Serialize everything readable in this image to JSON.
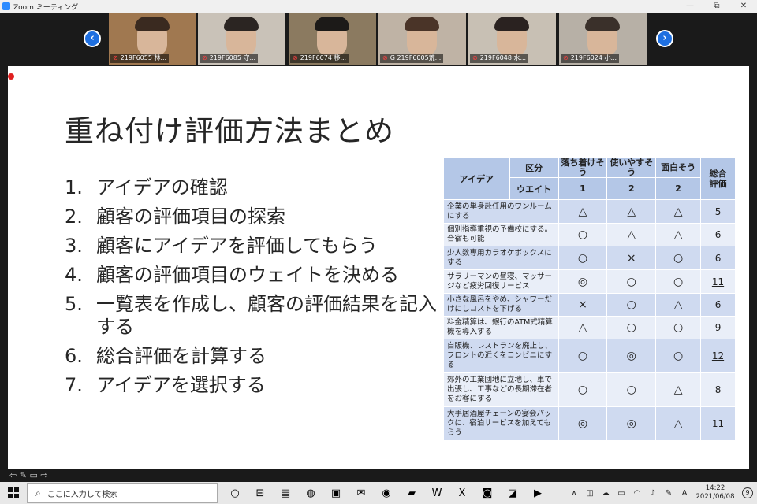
{
  "window": {
    "title": "Zoom ミーティング",
    "controls": [
      "—",
      "⧉",
      "✕"
    ]
  },
  "gallery": {
    "prev": "‹",
    "next": "›",
    "participants": [
      {
        "name": "219F6055 林...",
        "hair": "#3a2a20",
        "bg": "#a07850"
      },
      {
        "name": "219F6085 守...",
        "hair": "#2b2522",
        "bg": "#c9c2b8"
      },
      {
        "name": "219F6074 移...",
        "hair": "#1c1a18",
        "bg": "#8b7a60"
      },
      {
        "name": "G  219F6005荒...",
        "hair": "#4a3428",
        "bg": "#bfb3a5"
      },
      {
        "name": "219F6048 水...",
        "hair": "#2a2220",
        "bg": "#c8c0b4"
      },
      {
        "name": "219F6024 小...",
        "hair": "#3a302a",
        "bg": "#b7b0a6"
      }
    ]
  },
  "slide": {
    "title": "重ね付け評価方法まとめ",
    "steps": [
      {
        "num": "1.",
        "text": "アイデアの確認"
      },
      {
        "num": "2.",
        "text": "顧客の評価項目の探索"
      },
      {
        "num": "3.",
        "text": "顧客にアイデアを評価してもらう"
      },
      {
        "num": "4.",
        "text": "顧客の評価項目のウェイトを決める"
      },
      {
        "num": "5.",
        "text": "一覧表を作成し、顧客の評価結果を記入する"
      },
      {
        "num": "6.",
        "text": "総合評価を計算する"
      },
      {
        "num": "7.",
        "text": "アイデアを選択する"
      }
    ],
    "table": {
      "h_idea": "アイデア",
      "h_kubun": "区分",
      "h_weight": "ウエイト",
      "h_total": "総合評価",
      "criteria": [
        {
          "name": "落ち着けそう",
          "weight": "1"
        },
        {
          "name": "使いやすそう",
          "weight": "2"
        },
        {
          "name": "面白そう",
          "weight": "2"
        }
      ],
      "rows": [
        {
          "idea": "企業の単身赴任用のワンルームにする",
          "c1": "△",
          "c2": "△",
          "c3": "△",
          "total": "5",
          "ul": false
        },
        {
          "idea": "個別指導重視の予備校にする。合宿も可能",
          "c1": "○",
          "c2": "△",
          "c3": "△",
          "total": "6",
          "ul": false
        },
        {
          "idea": "少人数専用カラオケボックスにする",
          "c1": "○",
          "c2": "×",
          "c3": "○",
          "total": "6",
          "ul": false
        },
        {
          "idea": "サラリーマンの昼寝、マッサージなど疲労回復サービス",
          "c1": "◎",
          "c2": "○",
          "c3": "○",
          "total": "11",
          "ul": true
        },
        {
          "idea": "小さな風呂をやめ、シャワーだけにしコストを下げる",
          "c1": "×",
          "c2": "○",
          "c3": "△",
          "total": "6",
          "ul": false
        },
        {
          "idea": "料金精算は、銀行のATM式精算機を導入する",
          "c1": "△",
          "c2": "○",
          "c3": "○",
          "total": "9",
          "ul": false
        },
        {
          "idea": "自販機、レストランを廃止し、フロントの近くをコンビニにする",
          "c1": "○",
          "c2": "◎",
          "c3": "○",
          "total": "12",
          "ul": true
        },
        {
          "idea": "郊外の工業団地に立地し、車で出張し、工事などの長期滞在者をお客にする",
          "c1": "○",
          "c2": "○",
          "c3": "△",
          "total": "8",
          "ul": false
        },
        {
          "idea": "大手居酒屋チェーンの宴会パックに、宿泊サービスを加えてもらう",
          "c1": "◎",
          "c2": "◎",
          "c3": "△",
          "total": "11",
          "ul": true
        }
      ]
    }
  },
  "taskbar": {
    "search_placeholder": "ここに入力して検索",
    "icons": [
      "○",
      "⊟",
      "▤",
      "◍",
      "▣",
      "✉",
      "◉",
      "▰",
      "W",
      "X",
      "◙",
      "◪",
      "▶"
    ],
    "tray": [
      "∧",
      "◫",
      "☁",
      "▭",
      "◠",
      "♪",
      "✎",
      "A"
    ],
    "time": "14:22",
    "date": "2021/06/08",
    "notif": "9"
  },
  "colors": {
    "header": "#b4c7e7",
    "row_odd": "#cfdaf0",
    "row_even": "#e9eef8",
    "nav": "#1e6fe0"
  }
}
